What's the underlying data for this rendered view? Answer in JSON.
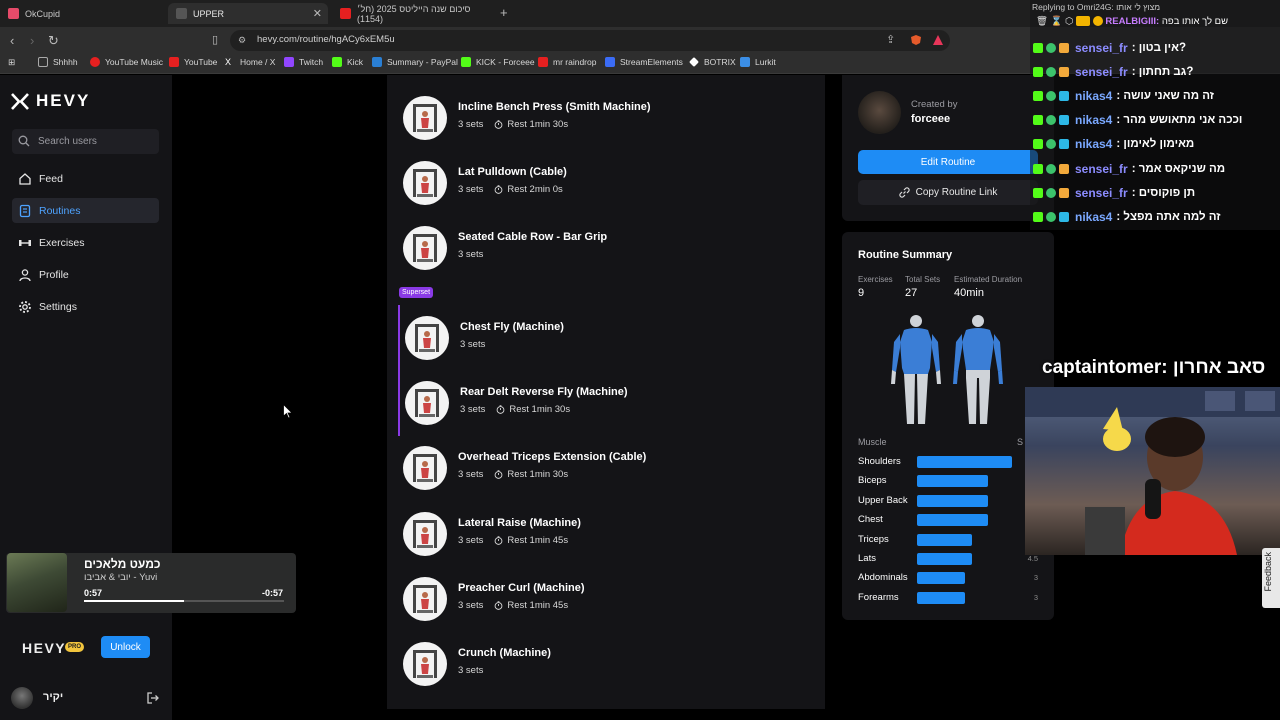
{
  "browser": {
    "tabs": [
      {
        "title": "OkCupid",
        "color": "#e64b6a"
      },
      {
        "title": "UPPER",
        "color": "#555555",
        "active": true
      },
      {
        "title": "סיכום שנה הייליטס 2025 (חל׳ (1154)",
        "color": "#e62020"
      }
    ],
    "url": "hevy.com/routine/hgACy6xEM5u",
    "bookmarks": [
      {
        "label": "Shhhh",
        "color": "#aaaaaa"
      },
      {
        "label": "YouTube Music",
        "color": "#e62020"
      },
      {
        "label": "YouTube",
        "color": "#e62020"
      },
      {
        "label": "Home / X",
        "color": "#ffffff"
      },
      {
        "label": "Twitch",
        "color": "#9146ff"
      },
      {
        "label": "Kick",
        "color": "#53fc18"
      },
      {
        "label": "Summary - PayPal",
        "color": "#2a7fd4"
      },
      {
        "label": "KICK - Forceee",
        "color": "#53fc18"
      },
      {
        "label": "mr raindrop",
        "color": "#e62020"
      },
      {
        "label": "StreamElements",
        "color": "#3b6cf6"
      },
      {
        "label": "BOTRIX",
        "color": "#ffffff"
      },
      {
        "label": "Lurkit",
        "color": "#3b8ee6"
      }
    ]
  },
  "sidebar": {
    "logo": "HEVY",
    "search_placeholder": "Search users",
    "nav": [
      {
        "label": "Feed",
        "icon": "home-icon"
      },
      {
        "label": "Routines",
        "icon": "routines-icon",
        "active": true
      },
      {
        "label": "Exercises",
        "icon": "dumbbell-icon"
      },
      {
        "label": "Profile",
        "icon": "profile-icon"
      },
      {
        "label": "Settings",
        "icon": "gear-icon"
      }
    ],
    "player": {
      "title": "כמעט מלאכים",
      "artist": "יובי & אביבו - Yuvi",
      "elapsed": "0:57",
      "remaining": "-0:57",
      "progress": 0.5
    },
    "pro": {
      "logo": "HEVY",
      "badge": "PRO",
      "unlock": "Unlock"
    },
    "user": {
      "name": "יקיר"
    }
  },
  "routine": {
    "superset_label": "Superset",
    "exercises": [
      {
        "name": "Incline Bench Press (Smith Machine)",
        "sets": "3 sets",
        "rest": "Rest 1min 30s"
      },
      {
        "name": "Lat Pulldown (Cable)",
        "sets": "3 sets",
        "rest": "Rest 2min 0s"
      },
      {
        "name": "Seated Cable Row - Bar Grip",
        "sets": "3 sets",
        "rest": ""
      },
      {
        "name": "Chest Fly (Machine)",
        "sets": "3 sets",
        "rest": ""
      },
      {
        "name": "Rear Delt Reverse Fly (Machine)",
        "sets": "3 sets",
        "rest": "Rest 1min 30s"
      },
      {
        "name": "Overhead Triceps Extension (Cable)",
        "sets": "3 sets",
        "rest": "Rest 1min 30s"
      },
      {
        "name": "Lateral Raise (Machine)",
        "sets": "3 sets",
        "rest": "Rest 1min 45s"
      },
      {
        "name": "Preacher Curl (Machine)",
        "sets": "3 sets",
        "rest": "Rest 1min 45s"
      },
      {
        "name": "Crunch (Machine)",
        "sets": "3 sets",
        "rest": ""
      }
    ]
  },
  "creator": {
    "label": "Created by",
    "name": "forceee",
    "edit": "Edit Routine",
    "copy": "Copy Routine Link"
  },
  "summary": {
    "title": "Routine Summary",
    "stats": [
      {
        "label": "Exercises",
        "value": "9"
      },
      {
        "label": "Total Sets",
        "value": "27"
      },
      {
        "label": "Estimated Duration",
        "value": "40min"
      }
    ],
    "muscle_header": "Muscle",
    "sets_header": "S",
    "muscles": [
      {
        "name": "Shoulders",
        "sets": 6,
        "value": ""
      },
      {
        "name": "Biceps",
        "sets": 4.5,
        "value": ""
      },
      {
        "name": "Upper Back",
        "sets": 4.5,
        "value": ""
      },
      {
        "name": "Chest",
        "sets": 4.5,
        "value": ""
      },
      {
        "name": "Triceps",
        "sets": 3.5,
        "value": ""
      },
      {
        "name": "Lats",
        "sets": 3.5,
        "value": "4.5"
      },
      {
        "name": "Abdominals",
        "sets": 3,
        "value": "3"
      },
      {
        "name": "Forearms",
        "sets": 3,
        "value": "3"
      }
    ]
  },
  "chat": {
    "reply_line": "Replying to Omri24G: מצוץ לי אותו",
    "reply_user": "REALBIGIII:",
    "reply_text": "שם לך אותו בפה",
    "messages": [
      {
        "user": "sensei_fr",
        "text": ": אין בטון?",
        "color": "#8c8cff"
      },
      {
        "user": "sensei_fr",
        "text": ": גב תחתון?",
        "color": "#8c8cff"
      },
      {
        "user": "nikas4",
        "text": ": זה מה שאני עושה",
        "color": "#7aa8ff"
      },
      {
        "user": "nikas4",
        "text": ": וככה אני מתאושש מהר",
        "color": "#7aa8ff"
      },
      {
        "user": "nikas4",
        "text": ": מאימון לאימון",
        "color": "#7aa8ff"
      },
      {
        "user": "sensei_fr",
        "text": ": מה שניקאס אמר",
        "color": "#8c8cff"
      },
      {
        "user": "sensei_fr",
        "text": ": תן פוקוסים",
        "color": "#8c8cff"
      },
      {
        "user": "nikas4",
        "text": ": זה למה אתה מפצל",
        "color": "#7aa8ff"
      }
    ],
    "cam_caption": "captaintomer: סאב אחרון"
  },
  "feedback": "Feedback"
}
